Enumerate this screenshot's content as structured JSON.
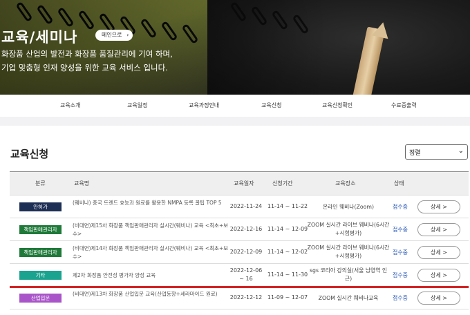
{
  "hero": {
    "title": "교육/세미나",
    "main_button": "메인으로",
    "main_button_arrow": "›",
    "desc_line1": "화장품 산업의 발전과 화장품 품질관리에 기여 하며,",
    "desc_line2": "기업 맞춤형 인재 양성을 위한 교육 서비스 입니다."
  },
  "subnav": {
    "items": [
      "교육소개",
      "교육일정",
      "교육과정안내",
      "교육신청",
      "교육신청확인",
      "수료증출력"
    ]
  },
  "section": {
    "title": "교육신청",
    "sort_value": "정렬",
    "sort_chevron": "⌄"
  },
  "table": {
    "headers": [
      "분류",
      "교육명",
      "교육일자",
      "신청기간",
      "교육장소",
      "상태"
    ],
    "rows": [
      {
        "badge": "안허가",
        "badge_color": "#1e2f55",
        "title": "(웨비나) 중국 트렌드 효능과 원료를 활용한 NMPA 등록 꿀팁 TOP 5",
        "date": "2022-11-24",
        "period": "11-14 ~ 11-22",
        "place": "온라인 웨비나(Zoom)",
        "status": "접수중",
        "detail": "상세 >"
      },
      {
        "badge": "책임판매관리자",
        "badge_color": "#1f7a3a",
        "title": "(비대면)제15차 화장품 책임판매관리자 실시간(웨비나) 교육 <최초+보수>",
        "date": "2022-12-16",
        "period": "11-14 ~ 12-09",
        "place": "ZOOM 실시간 라이브 웨비나(6시간+시험평가)",
        "status": "접수중",
        "detail": "상세 >"
      },
      {
        "badge": "책임판매관리자",
        "badge_color": "#1f7a3a",
        "title": "(비대면)제14차 화장품 책임판매관리자 실시간(웨비나) 교육 <최초+보수>",
        "date": "2022-12-09",
        "period": "11-14 ~ 12-02",
        "place": "ZOOM 실시간 라이브 웨비나(6시간+시험평가)",
        "status": "접수중",
        "detail": "상세 >"
      },
      {
        "badge": "기타",
        "badge_color": "#1aa38f",
        "title": "제2차 화장품 안전성 평가자 양성 교육",
        "date": "2022-12-06 ~ 16",
        "period": "11-14 ~ 11-30",
        "place": "sgs 코리아 강의실(서울 남영역 인근)",
        "status": "접수중",
        "detail": "상세 >"
      },
      {
        "badge": "산업입문",
        "badge_color": "#a955c9",
        "title": "(비대면)제13차 화장품 산업입문 교육(산업동향+세라마이드 원료)",
        "date": "2022-12-12",
        "period": "11-09 ~ 12-07",
        "place": "ZOOM 실시간 웨비나교육",
        "status": "접수중",
        "detail": "상세 >"
      }
    ]
  }
}
